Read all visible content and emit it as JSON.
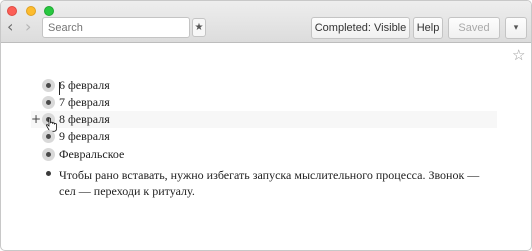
{
  "toolbar": {
    "back_icon": "chevron-left-icon",
    "forward_icon": "chevron-right-icon",
    "search_placeholder": "Search",
    "star_icon": "star-icon",
    "completed_label": "Completed: Visible",
    "help_label": "Help",
    "saved_label": "Saved",
    "menu_icon": "chevron-down-icon"
  },
  "outline": {
    "items": [
      {
        "text": "6 февраля"
      },
      {
        "text": "7 февраля"
      },
      {
        "text": "8 февраля",
        "add_marker": "+"
      },
      {
        "text": "9 февраля"
      },
      {
        "text": "Февральское"
      }
    ],
    "note": "Чтобы рано вставать, нужно избегать запуска мыслительного процесса. Звонок — сел — переходи к ритуалу."
  }
}
